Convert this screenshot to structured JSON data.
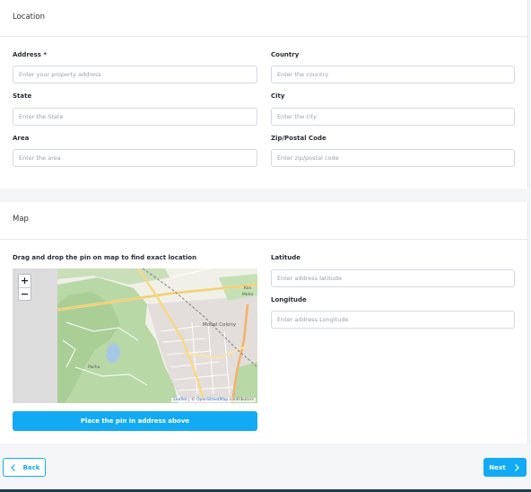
{
  "location": {
    "title": "Location",
    "fields": {
      "address": {
        "label": "Address *",
        "placeholder": "Enter your property address"
      },
      "country": {
        "label": "Country",
        "placeholder": "Enter the country"
      },
      "state": {
        "label": "State",
        "placeholder": "Enter the State"
      },
      "city": {
        "label": "City",
        "placeholder": "Enter the city"
      },
      "area": {
        "label": "Area",
        "placeholder": "Enter the area"
      },
      "zip": {
        "label": "Zip/Postal Code",
        "placeholder": "Enter zip/postal code"
      }
    }
  },
  "map_section": {
    "title": "Map",
    "instruction": "Drag and drop the pin on map to find exact location",
    "zoom_in": "+",
    "zoom_out": "−",
    "attribution_leaflet": "Leaflet",
    "attribution_sep": " | © ",
    "attribution_osm": "OpenStreetMap",
    "attribution_tail": " contributors",
    "place_names": {
      "model_colony": "Model Colony",
      "kon": "Kon",
      "moho": "Moho",
      "pachu": "Pachu"
    },
    "latitude": {
      "label": "Latitude",
      "placeholder": "Enter address latitude"
    },
    "longitude": {
      "label": "Longitude",
      "placeholder": "Enter address Longitude"
    },
    "place_pin_button": "Place the pin in address above"
  },
  "footer": {
    "back_label": "Back",
    "next_label": "Next"
  },
  "colors": {
    "accent": "#12aaf5",
    "background": "#f4f5f7"
  }
}
